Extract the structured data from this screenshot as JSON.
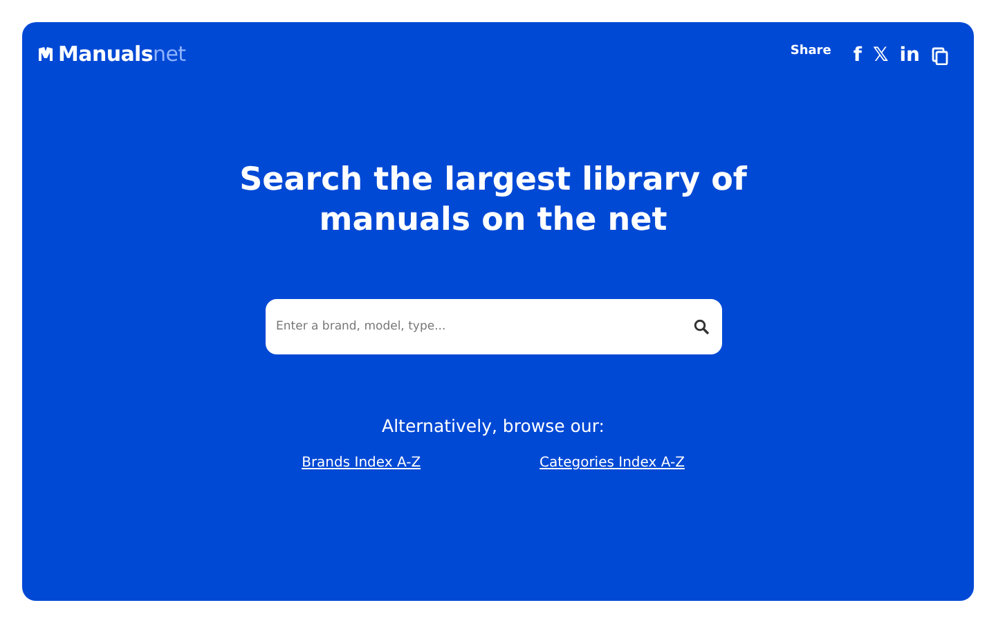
{
  "logo": {
    "name": "Manuals",
    "suffix": "net"
  },
  "share": {
    "label": "Share",
    "icons": [
      "f",
      "𝕏",
      "in"
    ]
  },
  "heading": [
    "Search the largest library of",
    "manuals on the net"
  ],
  "search": {
    "placeholder": "Enter a brand, model, type..."
  },
  "browse": {
    "label": "Alternatively, browse our:",
    "links": [
      "Brands Index A-Z",
      "Categories Index A-Z"
    ]
  }
}
